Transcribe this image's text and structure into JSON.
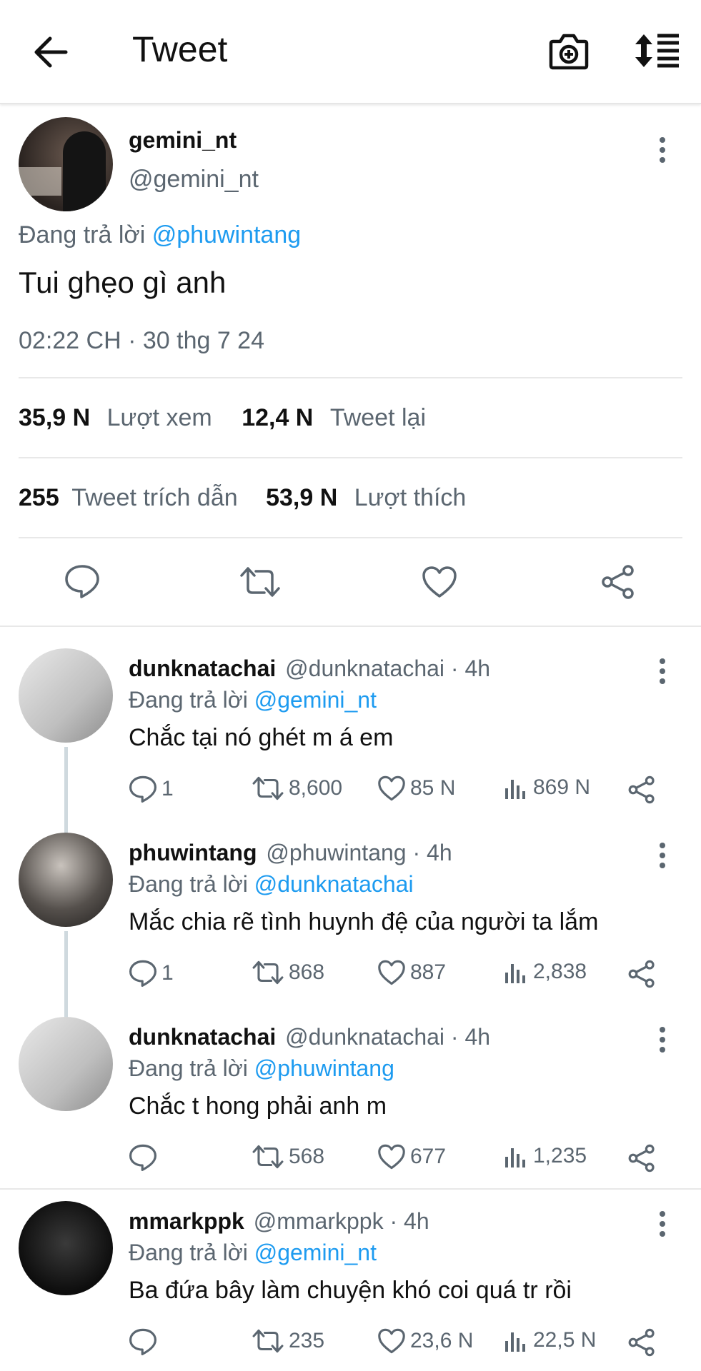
{
  "header": {
    "title": "Tweet"
  },
  "tweet": {
    "display_name": "gemini_nt",
    "handle": "@gemini_nt",
    "replying_label": "Đang trả lời",
    "replying_to": "@phuwintang",
    "text": "Tui ghẹo gì anh",
    "timestamp": "02:22 CH · 30 thg 7 24",
    "stats": {
      "views_count": "35,9 N",
      "views_label": "Lượt xem",
      "retweets_count": "12,4 N",
      "retweets_label": "Tweet lại",
      "quotes_count": "255",
      "quotes_label": "Tweet trích dẫn",
      "likes_count": "53,9 N",
      "likes_label": "Lượt thích"
    }
  },
  "replies": [
    {
      "display_name": "dunknatachai",
      "handle": "@dunknatachai · 4h",
      "replying_label": "Đang trả lời",
      "replying_to": "@gemini_nt",
      "text": "Chắc tại nó ghét m á em",
      "reply_count": "1",
      "retweet_count": "8,600",
      "like_count": "85 N",
      "view_count": "869 N"
    },
    {
      "display_name": "phuwintang",
      "handle": "@phuwintang · 4h",
      "replying_label": "Đang trả lời",
      "replying_to": "@dunknatachai",
      "text": "Mắc chia rẽ tình huynh đệ của người ta lắm",
      "reply_count": "1",
      "retweet_count": "868",
      "like_count": "887",
      "view_count": "2,838"
    },
    {
      "display_name": "dunknatachai",
      "handle": "@dunknatachai · 4h",
      "replying_label": "Đang trả lời",
      "replying_to": "@phuwintang",
      "text": "Chắc t hong phải anh m",
      "reply_count": "",
      "retweet_count": "568",
      "like_count": "677",
      "view_count": "1,235"
    },
    {
      "display_name": "mmarkppk",
      "handle": "@mmarkppk · 4h",
      "replying_label": "Đang trả lời",
      "replying_to": "@gemini_nt",
      "text": "Ba đứa bây làm chuyện khó coi quá tr rồi",
      "reply_count": "",
      "retweet_count": "235",
      "like_count": "23,6 N",
      "view_count": "22,5 N"
    }
  ],
  "colors": {
    "accent": "#1d9bf0",
    "muted": "#5b6670"
  }
}
